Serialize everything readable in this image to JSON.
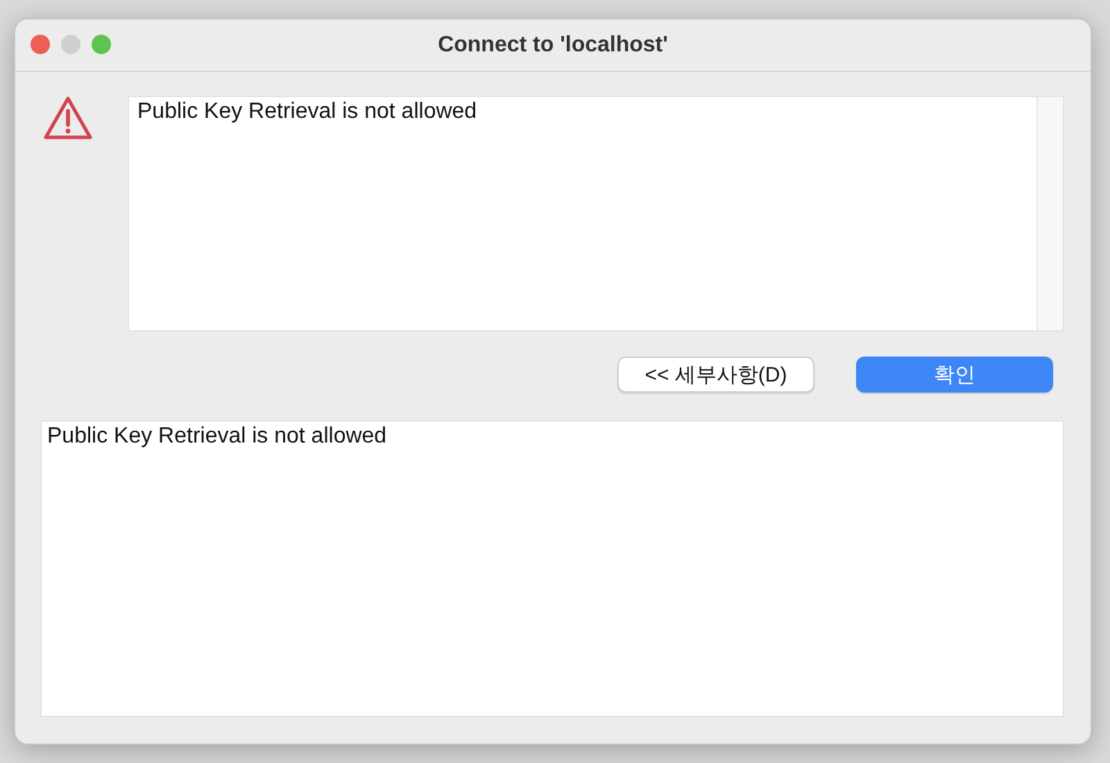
{
  "window": {
    "title": "Connect to 'localhost'"
  },
  "message": "Public Key Retrieval is not allowed",
  "buttons": [
    {
      "label": "<< 세부사항(D)",
      "kind": "secondary"
    },
    {
      "label": "확인",
      "kind": "primary"
    }
  ],
  "details": "Public Key Retrieval is not allowed"
}
